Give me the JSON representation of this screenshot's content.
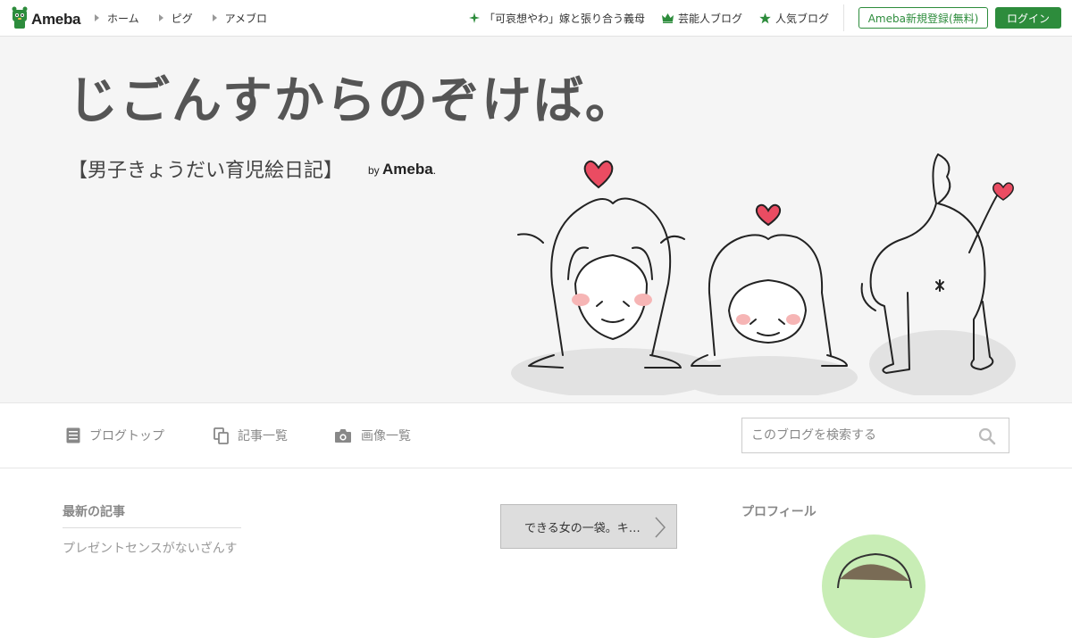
{
  "topbar": {
    "logo_text": "Ameba",
    "nav": [
      {
        "label": "ホーム"
      },
      {
        "label": "ピグ"
      },
      {
        "label": "アメブロ"
      }
    ],
    "right_nav": [
      {
        "label": "「可哀想やわ」嫁と張り合う義母",
        "icon": "sparkle-icon"
      },
      {
        "label": "芸能人ブログ",
        "icon": "crown-icon"
      },
      {
        "label": "人気ブログ",
        "icon": "star-icon"
      }
    ],
    "register_label": "Ameba新規登録(無料)",
    "login_label": "ログイン",
    "accent_color": "#2d8c3c"
  },
  "header": {
    "title": "じごんすからのぞけば。",
    "subtitle": "【男子きょうだい育児絵日記】",
    "by_prefix": "by",
    "by_brand": "Ameba",
    "by_suffix": ".",
    "background_color": "#f5f5f5"
  },
  "tabs": [
    {
      "label": "ブログトップ",
      "icon": "document-icon"
    },
    {
      "label": "記事一覧",
      "icon": "copy-icon"
    },
    {
      "label": "画像一覧",
      "icon": "camera-icon"
    }
  ],
  "search": {
    "placeholder": "このブログを検索する",
    "value": ""
  },
  "sidebar": {
    "heading": "最新の記事",
    "entries": [
      {
        "title": "プレゼントセンスがないざんす"
      }
    ]
  },
  "pager": {
    "label": "できる女の一袋。キ…"
  },
  "profile": {
    "heading": "プロフィール"
  }
}
